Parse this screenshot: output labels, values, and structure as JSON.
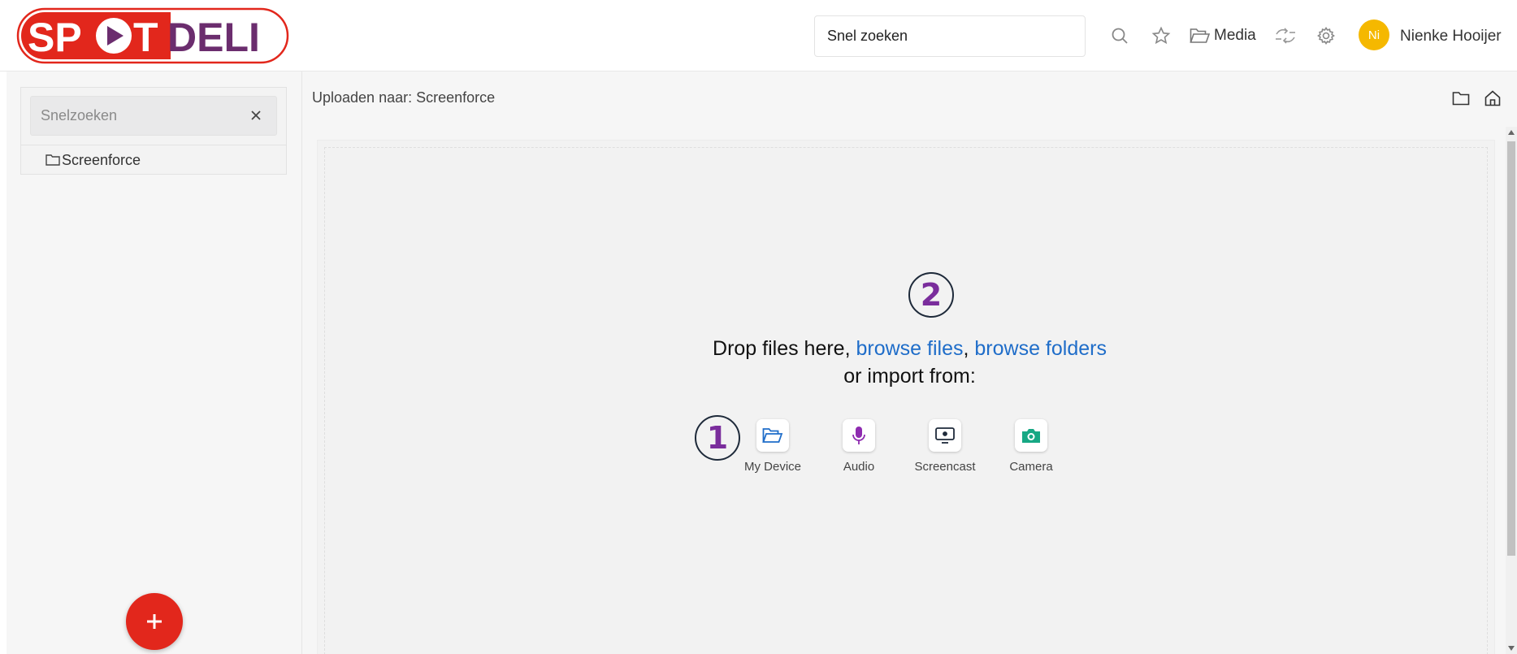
{
  "header": {
    "logo_text": "SPOTDELI",
    "search_value": "Snel zoeken",
    "media_label": "Media",
    "avatar_initials": "Ni",
    "user_name": "Nienke Hooijer"
  },
  "sidebar": {
    "search_placeholder": "Snelzoeken",
    "folders": [
      "Screenforce"
    ]
  },
  "main": {
    "breadcrumb": "Uploaden naar: Screenforce",
    "drop_text_prefix": "Drop files here, ",
    "browse_files": "browse files",
    "separator": ", ",
    "browse_folders": "browse folders",
    "drop_text_line2": "or import from:",
    "sources": [
      "My Device",
      "Audio",
      "Screencast",
      "Camera"
    ],
    "markers": [
      "1",
      "2"
    ]
  },
  "colors": {
    "brand_red": "#e2271c",
    "brand_purple": "#6b2d6e",
    "link_blue": "#1f6dc9",
    "avatar_yellow": "#f5b800",
    "audio_purple": "#8e2bb0",
    "camera_green": "#17a884"
  }
}
